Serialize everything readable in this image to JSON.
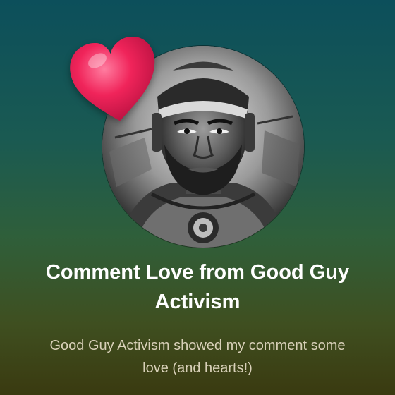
{
  "post": {
    "title": "Comment Love from Good Guy Activism",
    "subtitle": "Good Guy Activism showed my comment some love (and hearts!)",
    "avatar_icon": "profile-avatar-illustration",
    "heart_icon": "heart-icon"
  },
  "colors": {
    "gradient_top": "#0c4f5b",
    "gradient_bottom": "#3a3a10",
    "title_text": "#ffffff",
    "subtitle_text": "#d8d0b8",
    "heart": "#f0245a"
  }
}
